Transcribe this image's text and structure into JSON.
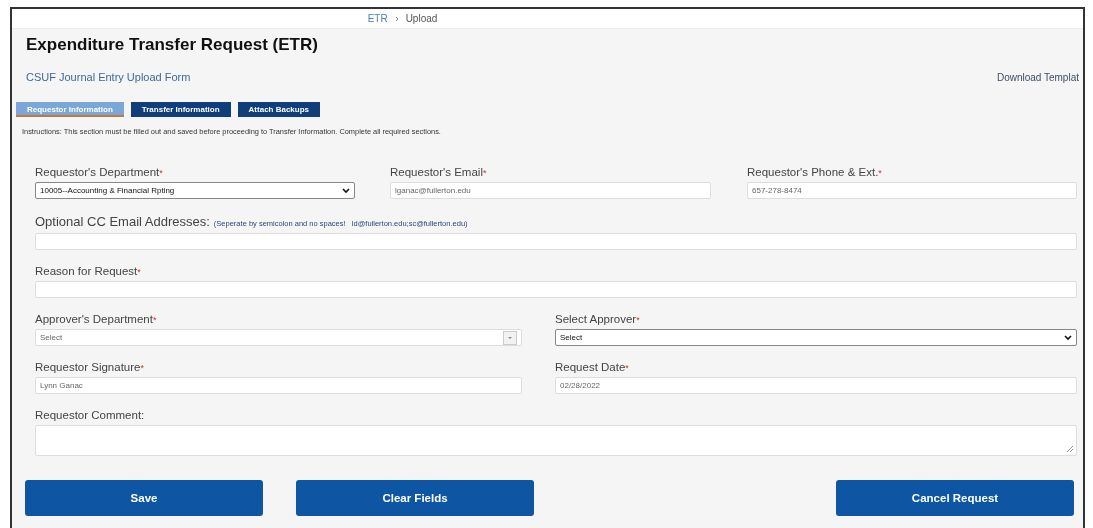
{
  "breadcrumb": [
    {
      "label": "ETR",
      "link": true
    },
    {
      "label": "Upload",
      "link": false
    }
  ],
  "title": "Expenditure Transfer Request (ETR)",
  "subtitle": "CSUF Journal Entry Upload Form",
  "download_link": "Download Templat",
  "tabs": [
    {
      "label": "Requestor Information",
      "selected": true
    },
    {
      "label": "Transfer Information",
      "selected": false
    },
    {
      "label": "Attach Backups",
      "selected": false
    }
  ],
  "instructions": "Instructions: This section must be filled out and saved before proceeding to Transfer Information. Complete all required sections.",
  "rows": [
    {
      "fields": [
        {
          "kind": "select",
          "label": "Requestor's Department",
          "asterisk": "*",
          "value": "10005--Accounting & Financial Rpting"
        },
        {
          "kind": "text",
          "label": "Requestor's Email",
          "asterisk": "*",
          "value": "lganac@fullerton.edu"
        },
        {
          "kind": "text",
          "label": "Requestor's Phone & Ext.",
          "asterisk": "*",
          "value": "657-278-8474"
        }
      ]
    },
    {
      "fields": [
        {
          "kind": "text",
          "label": "Optional CC Email Addresses:",
          "hint": "(Seperate by semicolon and no spaces!   ld@fullerton.edu;sc@fullerton.edu)",
          "large": true
        }
      ]
    },
    {
      "fields": [
        {
          "kind": "text",
          "label": "Reason for Request",
          "asterisk": "*"
        }
      ]
    },
    {
      "fields": [
        {
          "kind": "combo",
          "label": "Approver's Department",
          "asterisk": "*",
          "value": "Select"
        },
        {
          "kind": "select",
          "label": "Select Approver",
          "asterisk": "*",
          "value": "Select"
        }
      ]
    },
    {
      "fields": [
        {
          "kind": "text",
          "label": "Requestor Signature",
          "asterisk": "*",
          "value": "Lynn Ganac"
        },
        {
          "kind": "text",
          "label": "Request Date",
          "asterisk": "*",
          "value": "02/28/2022"
        }
      ]
    },
    {
      "fields": [
        {
          "kind": "textarea",
          "label": "Requestor Comment:"
        }
      ]
    }
  ],
  "buttons": [
    {
      "label": "Save"
    },
    {
      "label": "Clear Fields"
    },
    {
      "label": "Cancel Request"
    }
  ]
}
